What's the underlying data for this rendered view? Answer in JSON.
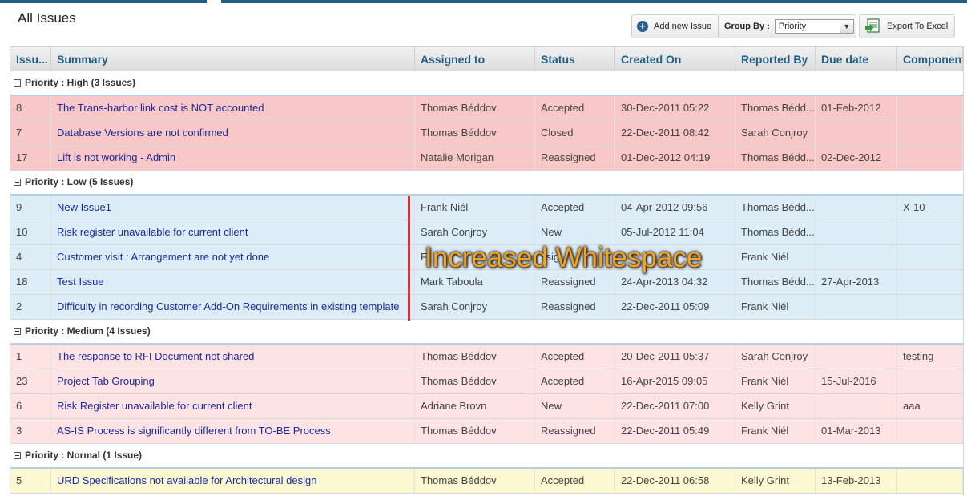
{
  "page": {
    "title": "All Issues"
  },
  "toolbar": {
    "add_label": "Add new Issue",
    "group_by_label": "Group By :",
    "group_by_value": "Priority",
    "export_label": "Export To Excel"
  },
  "grid": {
    "columns": [
      "Issu...",
      "Summary",
      "Assigned to",
      "Status",
      "Created On",
      "Reported By",
      "Due date",
      "Component"
    ],
    "groups": [
      {
        "label": "Priority : High (3 Issues)",
        "rows": [
          [
            "8",
            "The Trans-harbor link cost is NOT accounted",
            "Thomas Béddov",
            "Accepted",
            "30-Dec-2011 05:22",
            "Thomas Bédd...",
            "01-Feb-2012",
            ""
          ],
          [
            "7",
            "Database Versions are not confirmed",
            "Thomas Béddov",
            "Closed",
            "22-Dec-2011 08:42",
            "Sarah Conjroy",
            "",
            ""
          ],
          [
            "17",
            "Lift is not working - Admin",
            "Natalie Morigan",
            "Reassigned",
            "01-Dec-2012 04:19",
            "Thomas Bédd...",
            "02-Dec-2012",
            ""
          ]
        ]
      },
      {
        "label": "Priority : Low (5 Issues)",
        "rows": [
          [
            "9",
            "New Issue1",
            "Frank Niél",
            "Accepted",
            "04-Apr-2012 09:56",
            "Thomas Bédd...",
            "",
            "X-10"
          ],
          [
            "10",
            "Risk register unavailable for current client",
            "Sarah Conjroy",
            "New",
            "05-Jul-2012 11:04",
            "Thomas Bédd...",
            "",
            ""
          ],
          [
            "4",
            "Customer visit : Arrangement are not yet done",
            "F",
            "ssig",
            "",
            "Frank Niél",
            "",
            ""
          ],
          [
            "18",
            "Test Issue",
            "Mark Taboula",
            "Reassigned",
            "24-Apr-2013 04:32",
            "Thomas Bédd...",
            "27-Apr-2013",
            ""
          ],
          [
            "2",
            "Difficulty in recording Customer Add-On Requirements in existing template",
            "Sarah Conjroy",
            "Reassigned",
            "22-Dec-2011 05:09",
            "Frank Niél",
            "",
            ""
          ]
        ]
      },
      {
        "label": "Priority : Medium (4 Issues)",
        "rows": [
          [
            "1",
            "The response to RFI Document not shared",
            "Thomas Béddov",
            "Accepted",
            "20-Dec-2011 05:37",
            "Sarah Conjroy",
            "",
            "testing"
          ],
          [
            "23",
            "Project Tab Grouping",
            "Thomas Béddov",
            "Accepted",
            "16-Apr-2015 09:05",
            "Frank Niél",
            "15-Jul-2016",
            ""
          ],
          [
            "6",
            "Risk Register unavailable for current client",
            "Adriane Brovn",
            "New",
            "22-Dec-2011 07:00",
            "Kelly Grint",
            "",
            "aaa"
          ],
          [
            "3",
            "AS-IS Process is significantly different from TO-BE Process",
            "Thomas Béddov",
            "Reassigned",
            "22-Dec-2011 05:49",
            "Frank Niél",
            "01-Mar-2013",
            ""
          ]
        ]
      },
      {
        "label": "Priority : Normal (1 Issue)",
        "rows": [
          [
            "5",
            "URD Specifications not available for Architectural design",
            "Thomas Béddov",
            "Accepted",
            "22-Dec-2011 06:58",
            "Kelly Grint",
            "13-Feb-2013",
            ""
          ]
        ]
      }
    ]
  },
  "annotation": {
    "text": "Increased Whitespace",
    "color": "#f5a21e"
  },
  "colors": {
    "high": "#f8c8c8",
    "low": "#dcedf8",
    "medium": "#fde3e3",
    "normal": "#fcf9d2",
    "accent": "#1f5f86"
  }
}
